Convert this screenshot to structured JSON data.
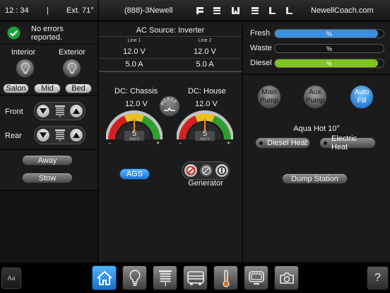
{
  "header": {
    "time": "12 : 34",
    "separator": "|",
    "ext_temp": "Ext. 71°",
    "phone": "(888)-3Newell",
    "site": "NewellCoach.com"
  },
  "status": {
    "message": "No errors reported."
  },
  "lights": {
    "interior_label": "Interior",
    "exterior_label": "Exterior",
    "buttons": [
      "Salon",
      "Mid",
      "Bed"
    ]
  },
  "shades": {
    "front_label": "Front",
    "rear_label": "Rear"
  },
  "modes": {
    "away_label": "Away",
    "stow_label": "Stow"
  },
  "ac": {
    "title": "AC Source: Inverter",
    "line1_label": "Line 1",
    "line2_label": "Line 2",
    "line1_voltage": "12.0 V",
    "line2_voltage": "12.0 V",
    "line1_current": "5.0 A",
    "line2_current": "5.0 A"
  },
  "dc": {
    "chassis_label": "DC: Chassis",
    "house_label": "DC: House",
    "merge_label": "MERGE",
    "chassis_voltage": "12.0 V",
    "house_voltage": "12.0 V",
    "chassis_amps": "5",
    "house_amps": "5",
    "amps_unit": "AMPS",
    "minus": "-",
    "plus": "+",
    "chassis_needle_fraction": 0.5,
    "house_needle_fraction": 0.5
  },
  "ags": {
    "label": "AGS"
  },
  "generator": {
    "label": "Generator"
  },
  "tanks": [
    {
      "name": "Fresh",
      "value_label": "%",
      "level_fraction": 0.95,
      "color": "#3b8fe0"
    },
    {
      "name": "Waste",
      "value_label": "%",
      "level_fraction": 0.0,
      "color": "#808080"
    },
    {
      "name": "Diesel",
      "value_label": "%",
      "level_fraction": 0.95,
      "color": "#7fc41f"
    }
  ],
  "pumps": {
    "main_label": "Main Pump",
    "aux_label": "Aux Pump",
    "auto_label": "Auto Fill"
  },
  "aquahot": {
    "title": "Aqua Hot 10°",
    "diesel_heat_label": "Diesel Heat",
    "electric_heat_label": "Electric Heat"
  },
  "dump": {
    "label": "Dump Station"
  },
  "footer": {
    "font_label": "Aa",
    "help_label": "?"
  },
  "colors": {
    "accent_blue": "#2f8ae6",
    "status_green": "#19a33a",
    "gauge_red": "#d42020",
    "gauge_green": "#2e9e2e"
  }
}
